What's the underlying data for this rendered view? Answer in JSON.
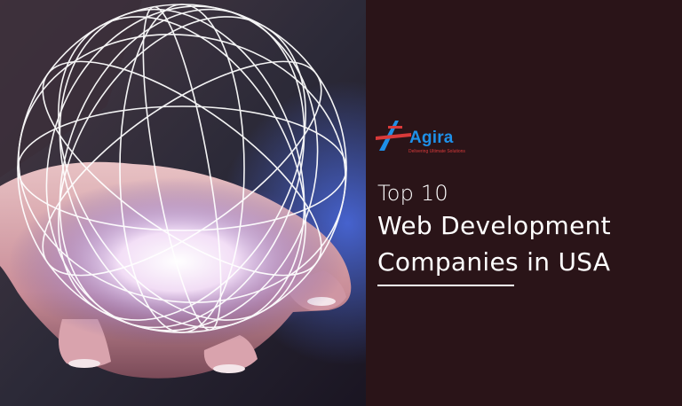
{
  "brand": {
    "name": "Agira",
    "tagline": "Delivering Ultimate Solutions",
    "primary_color": "#1e90e8",
    "accent_color": "#d93a3a"
  },
  "headline": {
    "line1": "Top 10",
    "line2": "Web Development",
    "line3": "Companies in USA"
  },
  "colors": {
    "panel_background": "#2a1418",
    "text": "#ffffff"
  },
  "image": {
    "subject": "hand-holding-glowing-wireframe-globe"
  }
}
